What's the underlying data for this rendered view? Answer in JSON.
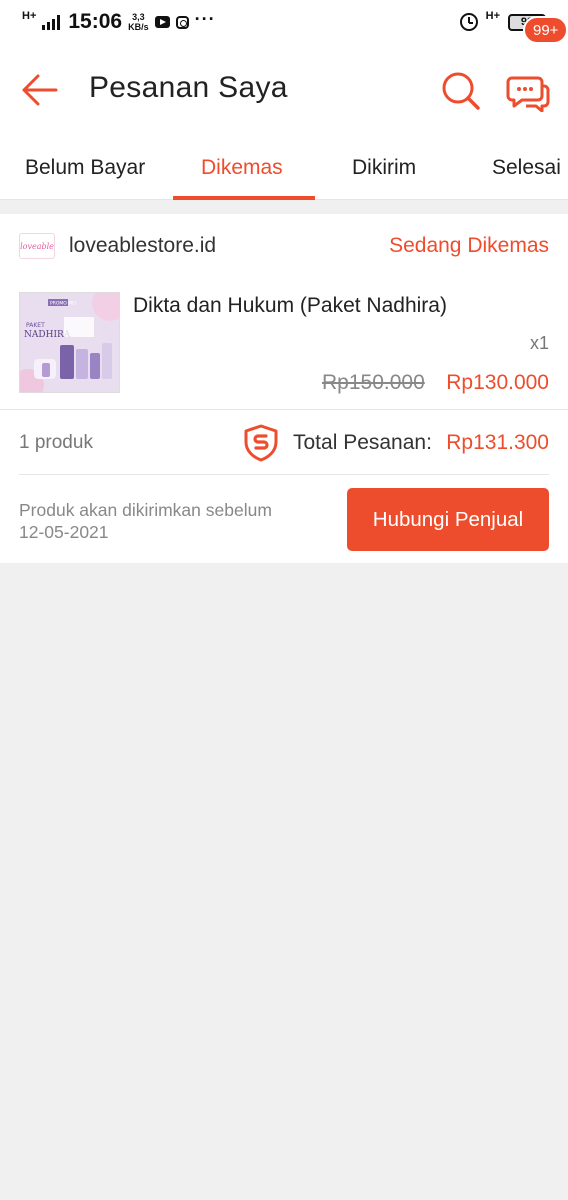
{
  "status_bar": {
    "network": "H+",
    "time": "15:06",
    "speed_value": "3,3",
    "speed_unit": "KB/s",
    "more": "···",
    "network_right": "H+",
    "battery": "92"
  },
  "app_bar": {
    "title": "Pesanan Saya",
    "chat_badge": "99+",
    "accent_color": "#ee4d2d"
  },
  "tabs": [
    {
      "label": "Belum Bayar",
      "active": false
    },
    {
      "label": "Dikemas",
      "active": true
    },
    {
      "label": "Dikirim",
      "active": false
    },
    {
      "label": "Selesai",
      "active": false
    }
  ],
  "order": {
    "shop_logo_text": "loveable",
    "shop_name": "loveablestore.id",
    "status": "Sedang Dikemas",
    "product": {
      "name": "Dikta dan Hukum (Paket Nadhira)",
      "quantity": "x1",
      "original_price": "Rp150.000",
      "price": "Rp130.000",
      "thumb_text": {
        "promo": "PROMO MEI",
        "paket": "PAKET",
        "nadhira": "NADHIRA"
      }
    },
    "item_count": "1 produk",
    "total_label": "Total Pesanan:",
    "total_value": "Rp131.300",
    "shipping_note_line1": "Produk akan dikirimkan sebelum",
    "shipping_note_line2": "12-05-2021",
    "contact_button": "Hubungi Penjual"
  }
}
